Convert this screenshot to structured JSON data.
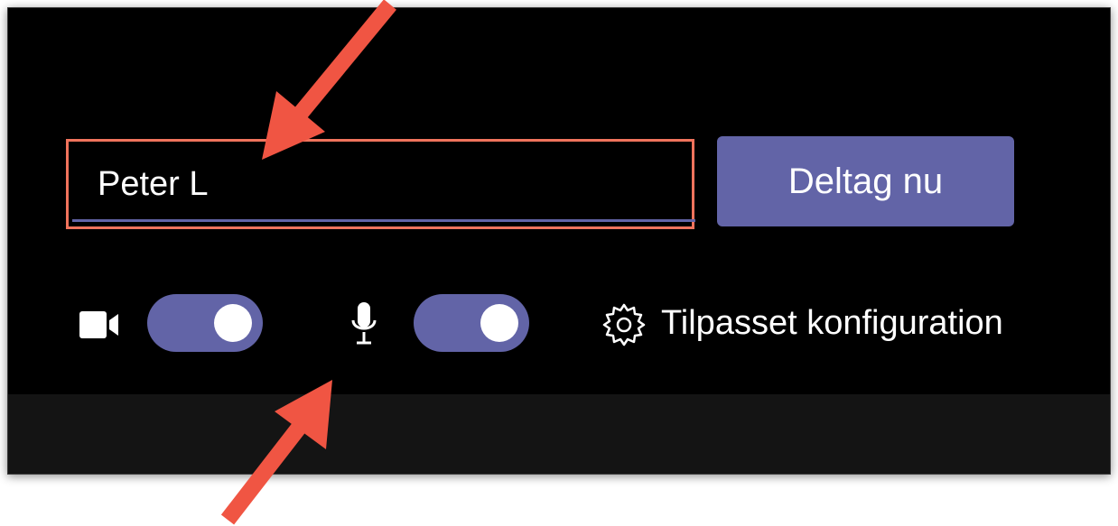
{
  "name_field": {
    "value": "Peter L"
  },
  "join_button": {
    "label": "Deltag nu"
  },
  "camera_toggle": {
    "state": "on"
  },
  "mic_toggle": {
    "state": "on"
  },
  "settings": {
    "label": "Tilpasset konfiguration"
  },
  "icons": {
    "camera": "camera-icon",
    "mic": "microphone-icon",
    "settings": "gear-icon"
  },
  "colors": {
    "accent": "#6264a7",
    "highlight": "#f0735c",
    "annotation_arrow": "#f05543",
    "background": "#000000"
  }
}
